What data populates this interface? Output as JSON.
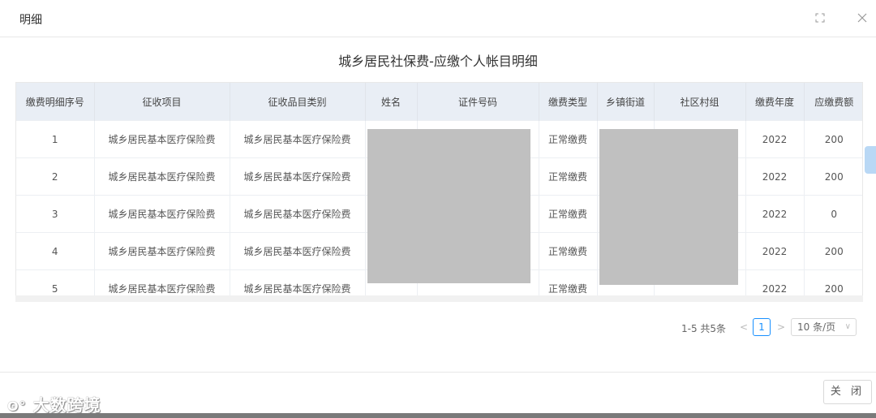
{
  "modal": {
    "title": "明细",
    "close_label": "关 闭"
  },
  "report": {
    "title": "城乡居民社保费-应缴个人帐目明细"
  },
  "table": {
    "headers": [
      "缴费明细序号",
      "征收项目",
      "征收品目类别",
      "姓名",
      "证件号码",
      "缴费类型",
      "乡镇街道",
      "社区村组",
      "缴费年度",
      "应缴费额"
    ],
    "rows": [
      [
        "1",
        "城乡居民基本医疗保险费",
        "城乡居民基本医疗保险费",
        "",
        "",
        "正常缴费",
        "",
        "",
        "2022",
        "200"
      ],
      [
        "2",
        "城乡居民基本医疗保险费",
        "城乡居民基本医疗保险费",
        "",
        "",
        "正常缴费",
        "",
        "",
        "2022",
        "200"
      ],
      [
        "3",
        "城乡居民基本医疗保险费",
        "城乡居民基本医疗保险费",
        "",
        "",
        "正常缴费",
        "",
        "",
        "2022",
        "0"
      ],
      [
        "4",
        "城乡居民基本医疗保险费",
        "城乡居民基本医疗保险费",
        "",
        "",
        "正常缴费",
        "",
        "",
        "2022",
        "200"
      ],
      [
        "5",
        "城乡居民基本医疗保险费",
        "城乡居民基本医疗保险费",
        "",
        "",
        "正常缴费",
        "",
        "",
        "2022",
        "200"
      ]
    ]
  },
  "pagination": {
    "total": "1-5 共5条",
    "current": "1",
    "page_size": "10 条/页"
  },
  "icons": {
    "fullscreen": "expand-icon",
    "close": "close-icon",
    "prev": "chevron-left-icon",
    "next": "chevron-right-icon"
  },
  "watermark": "大数跨境"
}
